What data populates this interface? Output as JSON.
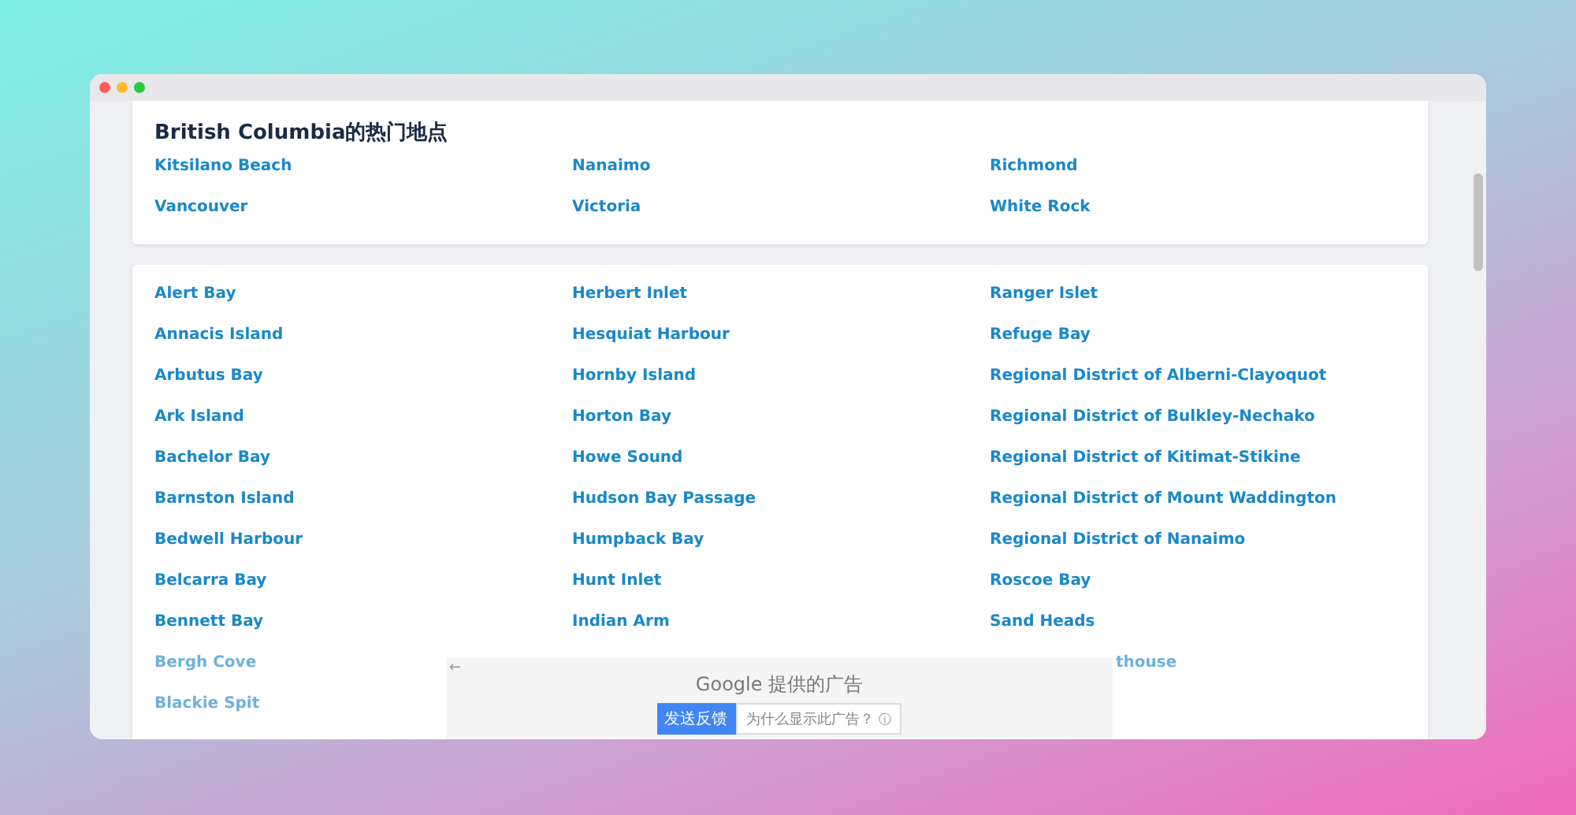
{
  "popular": {
    "title": "British Columbia的热门地点",
    "places": [
      "Kitsilano Beach",
      "Nanaimo",
      "Richmond",
      "Vancouver",
      "Victoria",
      "White Rock"
    ]
  },
  "places": [
    "Alert Bay",
    "Herbert Inlet",
    "Ranger Islet",
    "Annacis Island",
    "Hesquiat Harbour",
    "Refuge Bay",
    "Arbutus Bay",
    "Hornby Island",
    "Regional District of Alberni-Clayoquot",
    "Ark Island",
    "Horton Bay",
    "Regional District of Bulkley-Nechako",
    "Bachelor Bay",
    "Howe Sound",
    "Regional District of Kitimat-Stikine",
    "Barnston Island",
    "Hudson Bay Passage",
    "Regional District of Mount Waddington",
    "Bedwell Harbour",
    "Humpback Bay",
    "Regional District of Nanaimo",
    "Belcarra Bay",
    "Hunt Inlet",
    "Roscoe Bay",
    "Bennett Bay",
    "Indian Arm",
    "Sand Heads"
  ],
  "faded_rows": [
    {
      "column_1": "Bergh Cove",
      "column_3": "thouse"
    },
    {
      "column_1": "Blackie Spit"
    }
  ],
  "ad": {
    "back": "←",
    "title": "Google 提供的广告",
    "feedback": "发送反馈",
    "why": "为什么显示此广告？",
    "info": "ⓘ"
  }
}
